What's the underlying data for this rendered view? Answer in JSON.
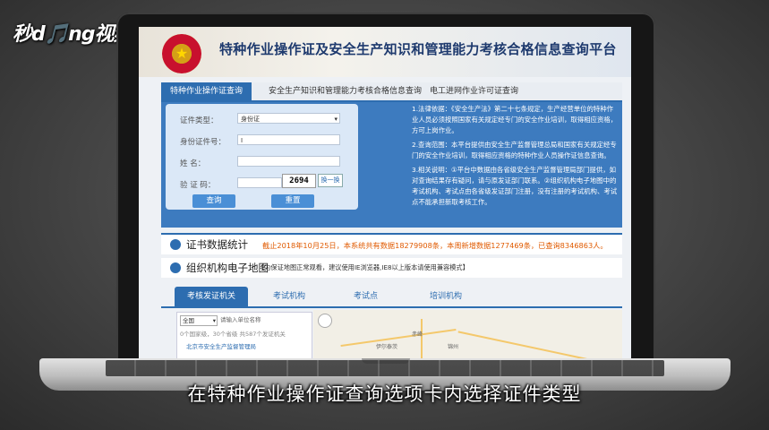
{
  "watermark": "秒d🎵ng视频",
  "subtitle": "在特种作业操作证查询选项卡内选择证件类型",
  "site": {
    "title": "特种作业操作证及安全生产知识和管理能力考核合格信息查询平台",
    "emblem_icon": "national-emblem-icon"
  },
  "tabs": [
    {
      "label": "特种作业操作证查询"
    },
    {
      "label": "安全生产知识和管理能力考核合格信息查询"
    },
    {
      "label": "电工进网作业许可证查询"
    }
  ],
  "form": {
    "cert_type_label": "证件类型：",
    "cert_type_value": "身份证",
    "id_label": "身份证件号：",
    "name_label": "姓      名：",
    "captcha_label": "验  证  码：",
    "captcha_value": "2694",
    "refresh_label": "换一换",
    "search_label": "查询",
    "reset_label": "重置"
  },
  "notes": [
    "1.法律依据：《安全生产法》第二十七条规定，生产经营单位的特种作业人员必须按照国家有关规定经专门的安全作业培训，取得相应资格，方可上岗作业。",
    "2.查询范围：本平台提供由安全生产监督管理总局和国家有关规定经专门的安全作业培训，取得相应资格的特种作业人员操作证信息查询。",
    "3.相关说明：①平台中数据由各省级安全生产监督管理局部门提供，如对查询结果存有疑问，请与原发证部门联系。②组织机构电子地图中的考试机构、考试点由各省级发证部门注册，没有注册的考试机构、考试点不能承担新取考核工作。"
  ],
  "stats": {
    "title": "证书数据统计",
    "text": "截止2018年10月25日，本系统共有数据18279908条，本周新增数据1277469条，已查询8346863人。"
  },
  "map": {
    "title": "组织机构电子地图",
    "note": "【为保证地图正常观看，建议使用IE浏览器,IE8以上版本请使用兼容模式】",
    "tabs": [
      "考核发证机关",
      "考试机构",
      "考试点",
      "培训机构"
    ],
    "region_select": "全国",
    "search_placeholder": "请输入单位名称",
    "result_info": "0个国家级，30个省级   共587个发证机关",
    "first_result": "北京市安全生产监督管理局",
    "places": [
      "伊尔泰茨",
      "赤峰",
      "锦州"
    ]
  }
}
